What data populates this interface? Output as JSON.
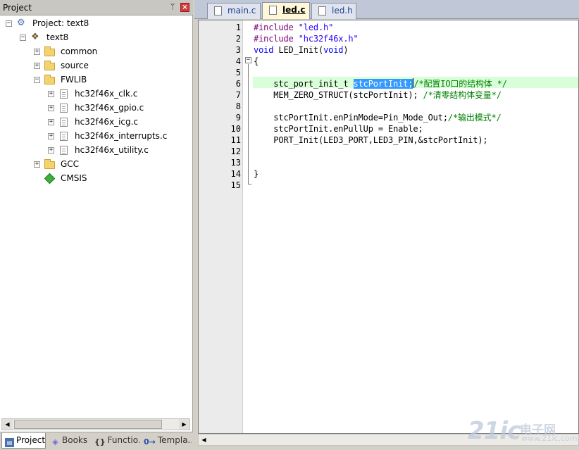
{
  "project_pane": {
    "title": "Project",
    "pin_glyph": "ᛘ",
    "close_glyph": "×",
    "tree": {
      "project": "Project: text8",
      "target": "text8",
      "groups": [
        "common",
        "source",
        "FWLIB"
      ],
      "fwlib_files": [
        "hc32f46x_clk.c",
        "hc32f46x_gpio.c",
        "hc32f46x_icg.c",
        "hc32f46x_interrupts.c",
        "hc32f46x_utility.c"
      ],
      "gcc": "GCC",
      "cmsis": "CMSIS"
    },
    "expanders": {
      "collapsed": "+",
      "expanded": "−"
    },
    "scroll_left": "◀",
    "scroll_right": "▶",
    "bottom_tabs": [
      {
        "label": "Project",
        "icon": "project-icon"
      },
      {
        "label": "Books",
        "icon": "books-icon"
      },
      {
        "label": "Functio...",
        "icon": "functions-icon",
        "glyph": "{}"
      },
      {
        "label": "Templa...",
        "icon": "templates-icon",
        "glyph": "0→"
      }
    ]
  },
  "editor": {
    "tabs": [
      {
        "label": "main.c",
        "active": false
      },
      {
        "label": "led.c",
        "active": true
      },
      {
        "label": "led.h",
        "active": false
      }
    ],
    "line_numbers": [
      "1",
      "2",
      "3",
      "4",
      "5",
      "6",
      "7",
      "8",
      "9",
      "10",
      "11",
      "12",
      "13",
      "14",
      "15"
    ],
    "fold_symbol": "−",
    "code": {
      "l1_pre": "#include",
      "l1_str": "\"led.h\"",
      "l2_pre": "#include",
      "l2_str": "\"hc32f46x.h\"",
      "l3_kw1": "void",
      "l3_plain": " LED_Init(",
      "l3_kw2": "void",
      "l3_end": ")",
      "l4": "{",
      "l6_plain": "    stc_port_init_t ",
      "l6_sel": "stcPortInit;",
      "l6_cmt": "/*配置IO口的结构体 */",
      "l7_plain": "    MEM_ZERO_STRUCT(stcPortInit); ",
      "l7_cmt": "/*清零结构体变量*/",
      "l9_plain": "    stcPortInit.enPinMode=Pin_Mode_Out;",
      "l9_cmt": "/*输出模式*/",
      "l10": "    stcPortInit.enPullUp = Enable;",
      "l11": "    PORT_Init(LED3_PORT,LED3_PIN,&stcPortInit);",
      "l14": "}"
    },
    "scroll_left": "◀",
    "colors": {
      "preprocessor": "#7f007f",
      "string": "#2a00ff",
      "keyword": "#0000ff",
      "comment": "#008000",
      "selection": "#3399ff",
      "current_line": "#d9ffd9"
    }
  },
  "watermark": {
    "logo": "21ic",
    "text": "电子网",
    "url": "www.21ic.com"
  }
}
